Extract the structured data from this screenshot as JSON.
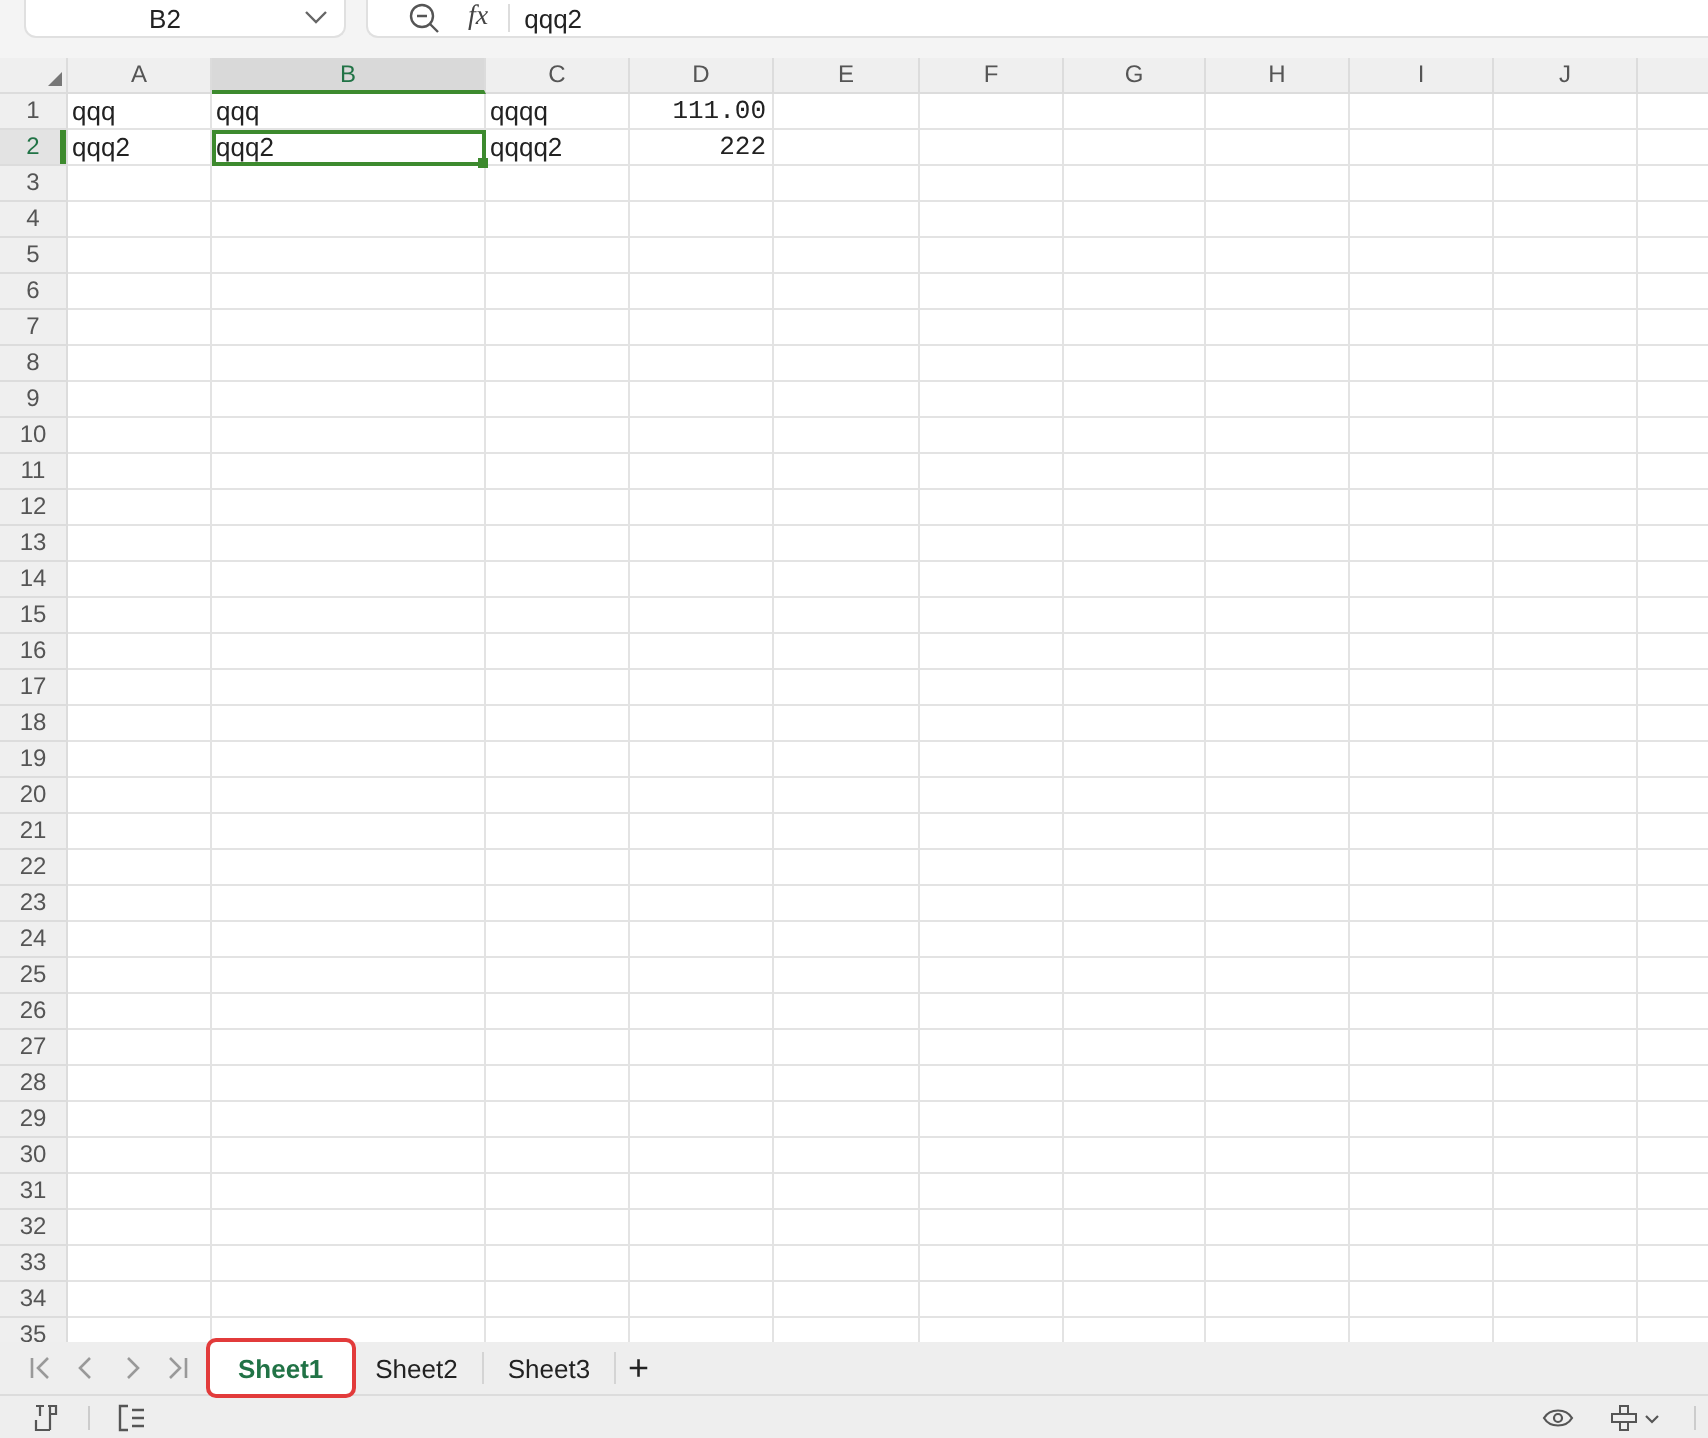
{
  "formula_bar": {
    "name_box": "B2",
    "function_label": "fx",
    "value": "qqq2"
  },
  "columns": [
    {
      "label": "A",
      "selected": false
    },
    {
      "label": "B",
      "selected": true
    },
    {
      "label": "C",
      "selected": false
    },
    {
      "label": "D",
      "selected": false
    },
    {
      "label": "E",
      "selected": false
    },
    {
      "label": "F",
      "selected": false
    },
    {
      "label": "G",
      "selected": false
    },
    {
      "label": "H",
      "selected": false
    },
    {
      "label": "I",
      "selected": false
    },
    {
      "label": "J",
      "selected": false
    }
  ],
  "rows": [
    {
      "label": "1",
      "selected": false,
      "cells": [
        {
          "text": "qqq",
          "kind": "text",
          "selected": false
        },
        {
          "text": "qqq",
          "kind": "text",
          "selected": false
        },
        {
          "text": "qqqq",
          "kind": "text",
          "selected": false
        },
        {
          "text": "111.00",
          "kind": "number",
          "selected": false
        }
      ]
    },
    {
      "label": "2",
      "selected": true,
      "cells": [
        {
          "text": "qqq2",
          "kind": "text",
          "selected": false
        },
        {
          "text": "qqq2",
          "kind": "text",
          "selected": true
        },
        {
          "text": "qqqq2",
          "kind": "text",
          "selected": false
        },
        {
          "text": "222",
          "kind": "number",
          "selected": false
        }
      ]
    },
    {
      "label": "3",
      "selected": false
    },
    {
      "label": "4",
      "selected": false
    },
    {
      "label": "5",
      "selected": false
    },
    {
      "label": "6",
      "selected": false
    },
    {
      "label": "7",
      "selected": false
    },
    {
      "label": "8",
      "selected": false
    },
    {
      "label": "9",
      "selected": false
    },
    {
      "label": "10",
      "selected": false
    },
    {
      "label": "11",
      "selected": false
    },
    {
      "label": "12",
      "selected": false
    },
    {
      "label": "13",
      "selected": false
    },
    {
      "label": "14",
      "selected": false
    },
    {
      "label": "15",
      "selected": false
    },
    {
      "label": "16",
      "selected": false
    },
    {
      "label": "17",
      "selected": false
    },
    {
      "label": "18",
      "selected": false
    },
    {
      "label": "19",
      "selected": false
    },
    {
      "label": "20",
      "selected": false
    },
    {
      "label": "21",
      "selected": false
    },
    {
      "label": "22",
      "selected": false
    },
    {
      "label": "23",
      "selected": false
    },
    {
      "label": "24",
      "selected": false
    },
    {
      "label": "25",
      "selected": false
    },
    {
      "label": "26",
      "selected": false
    },
    {
      "label": "27",
      "selected": false
    },
    {
      "label": "28",
      "selected": false
    },
    {
      "label": "29",
      "selected": false
    },
    {
      "label": "30",
      "selected": false
    },
    {
      "label": "31",
      "selected": false
    },
    {
      "label": "32",
      "selected": false
    },
    {
      "label": "33",
      "selected": false
    },
    {
      "label": "34",
      "selected": false
    },
    {
      "label": "35",
      "selected": false
    }
  ],
  "sheet_tabs": [
    {
      "label": "Sheet1",
      "selected": true,
      "outlined": true
    },
    {
      "label": "Sheet2",
      "selected": false,
      "outlined": false
    },
    {
      "label": "Sheet3",
      "selected": false,
      "outlined": false
    }
  ],
  "add_sheet": "+"
}
